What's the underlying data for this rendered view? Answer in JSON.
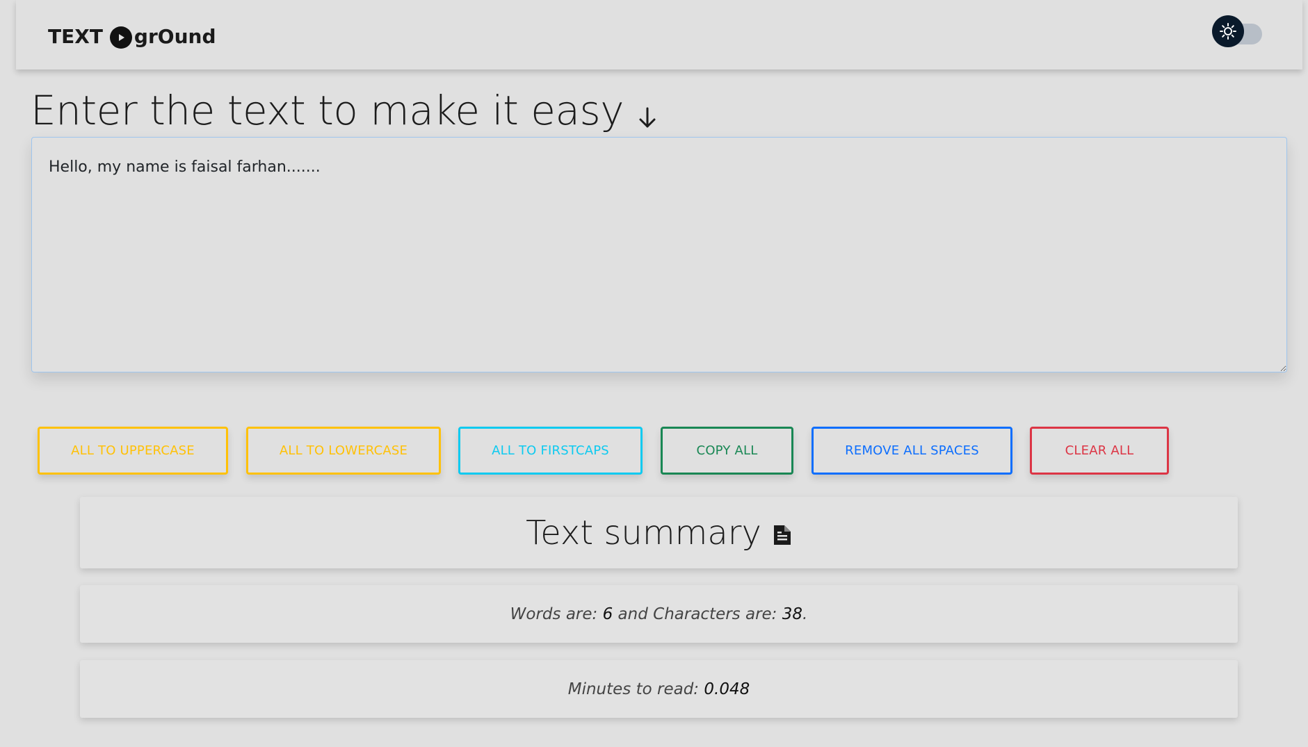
{
  "navbar": {
    "brand_prefix": "TEXT",
    "brand_suffix": "grOund",
    "theme_toggle_icon": "sun-icon"
  },
  "main": {
    "heading": "Enter the text to make it easy",
    "heading_icon": "arrow-down-icon",
    "textarea_value": "Hello, my name is faisal farhan......."
  },
  "buttons": [
    {
      "label": "ALL TO UPPERCASE",
      "color": "#ffc107"
    },
    {
      "label": "ALL TO LOWERCASE",
      "color": "#ffc107"
    },
    {
      "label": "ALL TO FIRSTCAPS",
      "color": "#0dcaf0"
    },
    {
      "label": "COPY ALL",
      "color": "#198754"
    },
    {
      "label": "REMOVE ALL SPACES",
      "color": "#0d6efd"
    },
    {
      "label": "CLEAR ALL",
      "color": "#dc3545"
    }
  ],
  "summary": {
    "title": "Text summary",
    "title_icon": "document-icon",
    "words_label": "Words are:",
    "words_value": "6",
    "chars_label": "and Characters are:",
    "chars_value": "38",
    "chars_suffix": ".",
    "read_label": "Minutes to read:",
    "read_value": "0.048"
  }
}
